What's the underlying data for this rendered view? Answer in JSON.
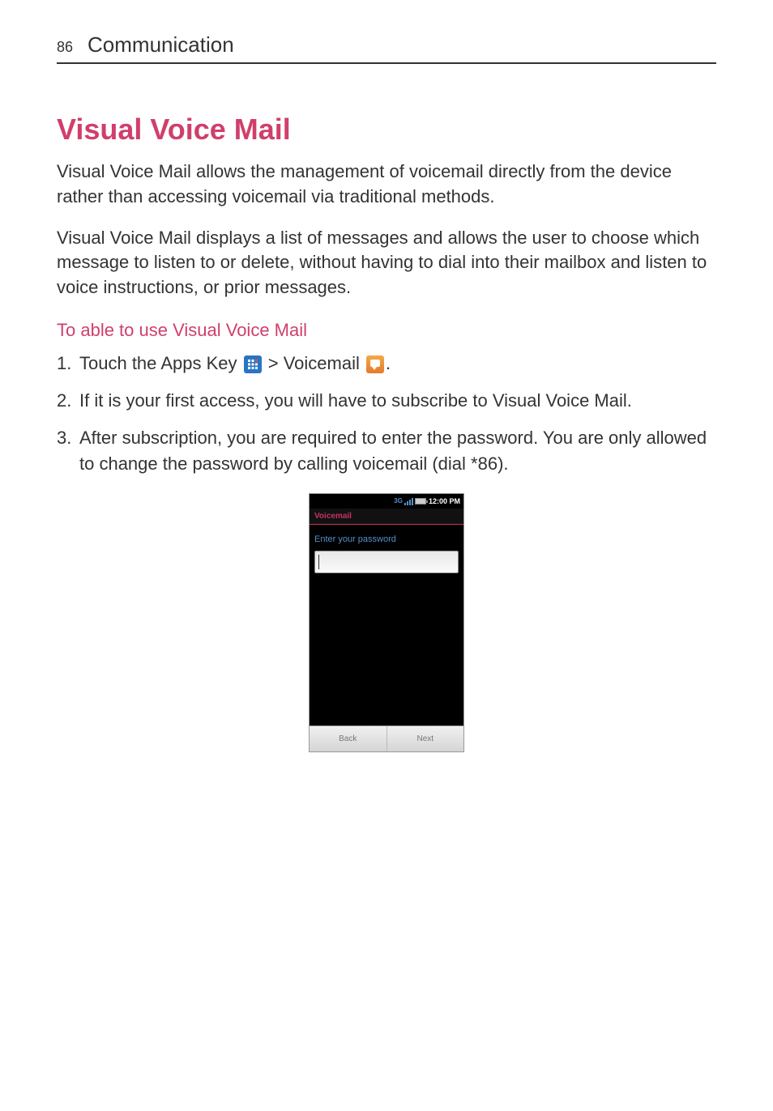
{
  "header": {
    "page_number": "86",
    "section": "Communication"
  },
  "heading": "Visual Voice Mail",
  "paragraphs": {
    "p1": "Visual Voice Mail allows the management of voicemail directly from the device rather than accessing voicemail via traditional methods.",
    "p2": "Visual Voice Mail displays a list of messages and allows the user to choose which message to listen to or delete, without having to dial into their mailbox and listen to voice instructions, or prior messages."
  },
  "sub_heading": "To able to use Visual Voice Mail",
  "steps": {
    "s1_num": "1.",
    "s1_prefix": "Touch the ",
    "s1_apps": "Apps Key",
    "s1_mid": " > ",
    "s1_vm": "Voicemail",
    "s1_suffix": ".",
    "s2_num": "2.",
    "s2_text": "If it is your first access, you will have to subscribe to Visual Voice Mail.",
    "s3_num": "3.",
    "s3_text": "After subscription, you are required to enter the password. You are only allowed to change the password by calling voicemail (dial *86)."
  },
  "screenshot": {
    "time": "12:00 PM",
    "network": "3G",
    "app_title": "Voicemail",
    "prompt": "Enter your password",
    "back_btn": "Back",
    "next_btn": "Next"
  }
}
